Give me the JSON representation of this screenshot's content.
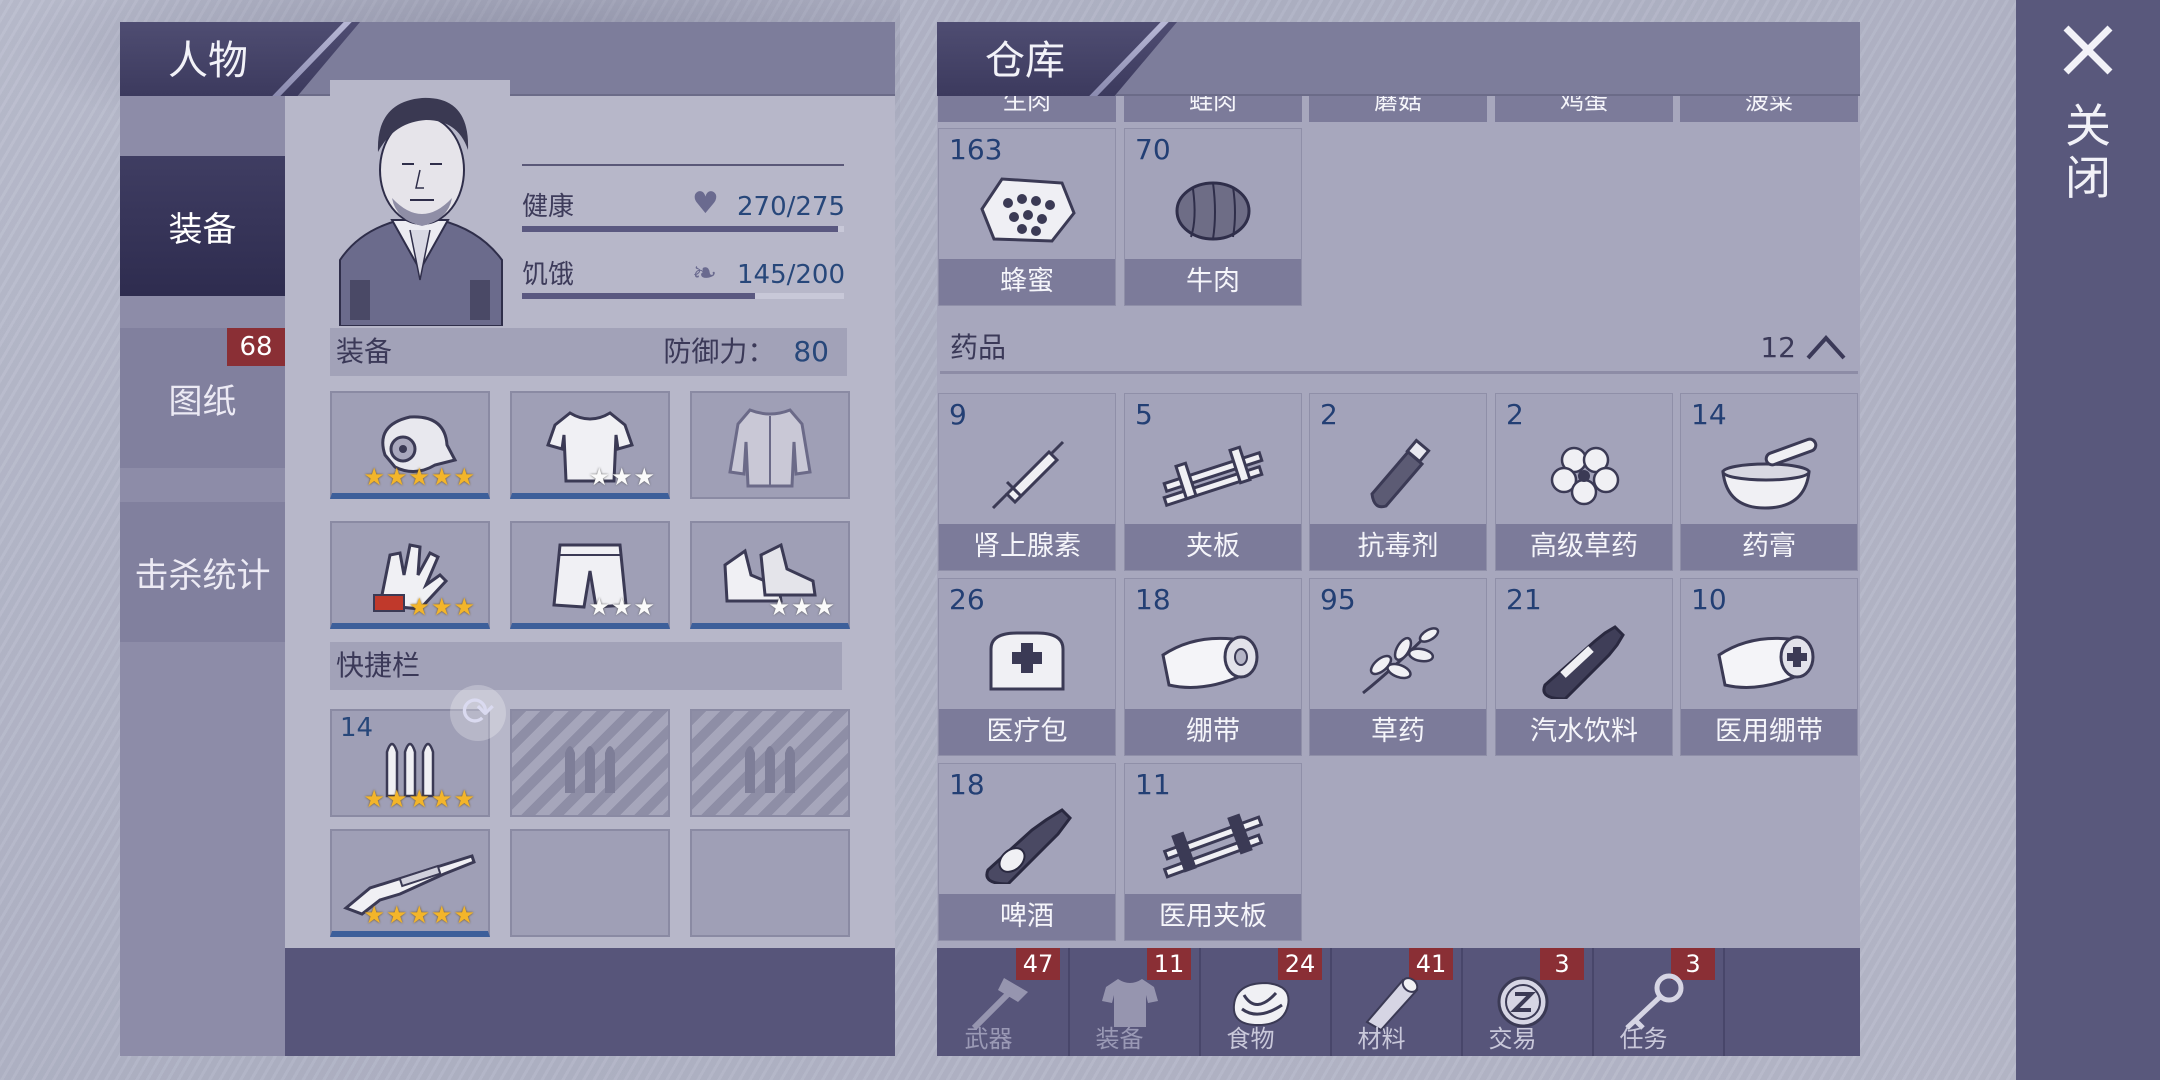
{
  "character": {
    "title": "人物",
    "tabs": [
      {
        "label": "装备",
        "active": true
      },
      {
        "label": "图纸",
        "badge": "68"
      },
      {
        "label": "击杀统计"
      }
    ],
    "stats": {
      "health_label": "健康",
      "health_value": "270/275",
      "health_ratio": 0.98,
      "hunger_label": "饥饿",
      "hunger_value": "145/200",
      "hunger_ratio": 0.725
    },
    "equipment": {
      "label": "装备",
      "defense_label": "防御力：",
      "defense_value": "80",
      "slots": [
        {
          "icon": "gas-mask",
          "stars": "★★★★★",
          "star_color": "gold"
        },
        {
          "icon": "shirt",
          "stars": "★★★",
          "star_color": "white"
        },
        {
          "icon": "jacket",
          "stars": "",
          "star_color": ""
        },
        {
          "icon": "gloves",
          "stars": "★★★",
          "star_color": "gold"
        },
        {
          "icon": "shorts",
          "stars": "★★★",
          "star_color": "white"
        },
        {
          "icon": "sneakers",
          "stars": "★★★",
          "star_color": "white"
        }
      ]
    },
    "quickbar": {
      "label": "快捷栏",
      "ammo_count": "14",
      "ammo_stars": "★★★★★",
      "rifle_stars": "★★★★★"
    }
  },
  "warehouse": {
    "title": "仓库",
    "clipped_items": [
      "生肉",
      "蛙肉",
      "蘑菇",
      "鸡蛋",
      "菠菜"
    ],
    "food_items": [
      {
        "count": "163",
        "name": "蜂蜜",
        "icon": "honeycomb"
      },
      {
        "count": "70",
        "name": "牛肉",
        "icon": "beef"
      }
    ],
    "medicine": {
      "label": "药品",
      "count": "12",
      "items": [
        {
          "count": "9",
          "name": "肾上腺素",
          "icon": "syringe"
        },
        {
          "count": "5",
          "name": "夹板",
          "icon": "splint"
        },
        {
          "count": "2",
          "name": "抗毒剂",
          "icon": "vial"
        },
        {
          "count": "2",
          "name": "高级草药",
          "icon": "clover"
        },
        {
          "count": "14",
          "name": "药膏",
          "icon": "mortar"
        },
        {
          "count": "26",
          "name": "医疗包",
          "icon": "medkit"
        },
        {
          "count": "18",
          "name": "绷带",
          "icon": "bandage"
        },
        {
          "count": "95",
          "name": "草药",
          "icon": "herb"
        },
        {
          "count": "21",
          "name": "汽水饮料",
          "icon": "soda"
        },
        {
          "count": "10",
          "name": "医用绷带",
          "icon": "med-bandage"
        },
        {
          "count": "18",
          "name": "啤酒",
          "icon": "beer"
        },
        {
          "count": "11",
          "name": "医用夹板",
          "icon": "med-splint"
        }
      ]
    },
    "bottom_tabs": [
      {
        "label": "武器",
        "badge": "47",
        "icon": "axe"
      },
      {
        "label": "装备",
        "badge": "11",
        "icon": "shirt"
      },
      {
        "label": "食物",
        "badge": "24",
        "icon": "steak"
      },
      {
        "label": "材料",
        "badge": "41",
        "icon": "log"
      },
      {
        "label": "交易",
        "badge": "3",
        "icon": "coin"
      },
      {
        "label": "任务",
        "badge": "3",
        "icon": "key"
      }
    ]
  },
  "close": {
    "label": "关闭"
  },
  "colors": {
    "accent": "#27477a",
    "badge": "#8a2f35",
    "star_gold": "#f3b52a"
  }
}
